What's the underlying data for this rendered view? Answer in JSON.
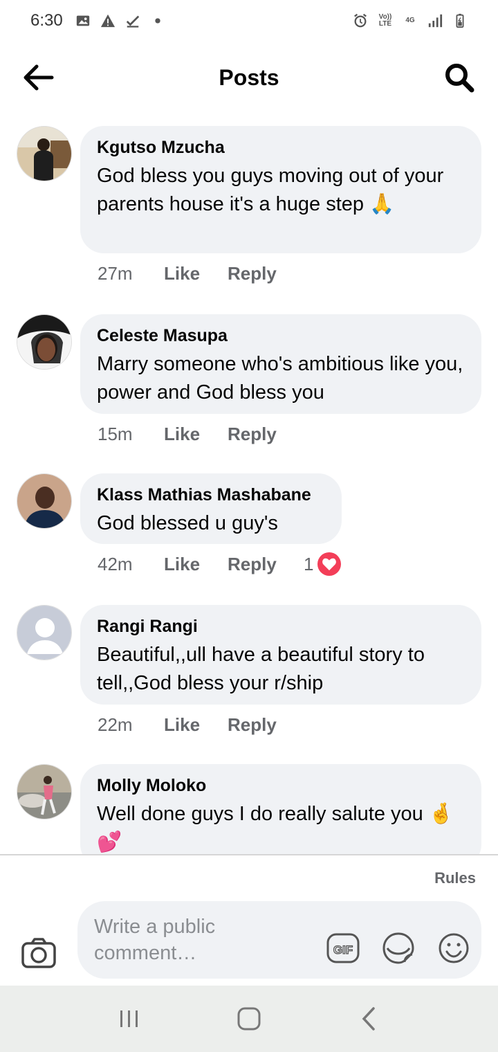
{
  "status_bar": {
    "time": "6:30",
    "left_icons": [
      "image-icon",
      "warning-icon",
      "download-done-icon",
      "dot-icon"
    ],
    "right_icons": [
      "alarm-icon",
      "volte-icon",
      "4g-icon",
      "signal-icon",
      "battery-icon"
    ],
    "volte_label": "Vo)) LTE",
    "network_label": "4G"
  },
  "header": {
    "title": "Posts",
    "back_icon": "arrow-left-icon",
    "search_icon": "search-icon"
  },
  "comments": [
    {
      "author": "Kgutso Mzucha",
      "text": "God bless you guys moving out of your parents house it's a huge step 🙏",
      "time": "27m",
      "like": "Like",
      "reply": "Reply"
    },
    {
      "author": "Celeste Masupa",
      "text": "Marry someone who's ambitious like you, power and God bless you",
      "time": "15m",
      "like": "Like",
      "reply": "Reply"
    },
    {
      "author": "Klass Mathias Mashabane",
      "text": "God blessed u guy's",
      "time": "42m",
      "like": "Like",
      "reply": "Reply",
      "reaction_count": "1",
      "reaction": "heart-icon"
    },
    {
      "author": "Rangi Rangi",
      "text": "Beautiful,,ull have a beautiful story to tell,,God bless your r/ship",
      "time": "22m",
      "like": "Like",
      "reply": "Reply"
    },
    {
      "author": "Molly Moloko",
      "text": "Well done guys I do really salute you 🤞💕",
      "time": "",
      "like": "",
      "reply": ""
    }
  ],
  "composer": {
    "rules": "Rules",
    "placeholder": "Write a public comment…",
    "placeholder_line1": "Write a public",
    "placeholder_line2": "comment…",
    "gif_label": "GIF"
  },
  "navbar": {
    "icons": [
      "recents-icon",
      "home-icon",
      "back-icon"
    ]
  },
  "colors": {
    "bubble": "#f0f2f5",
    "secondary_text": "#65676b",
    "heart": "#f33e58"
  }
}
